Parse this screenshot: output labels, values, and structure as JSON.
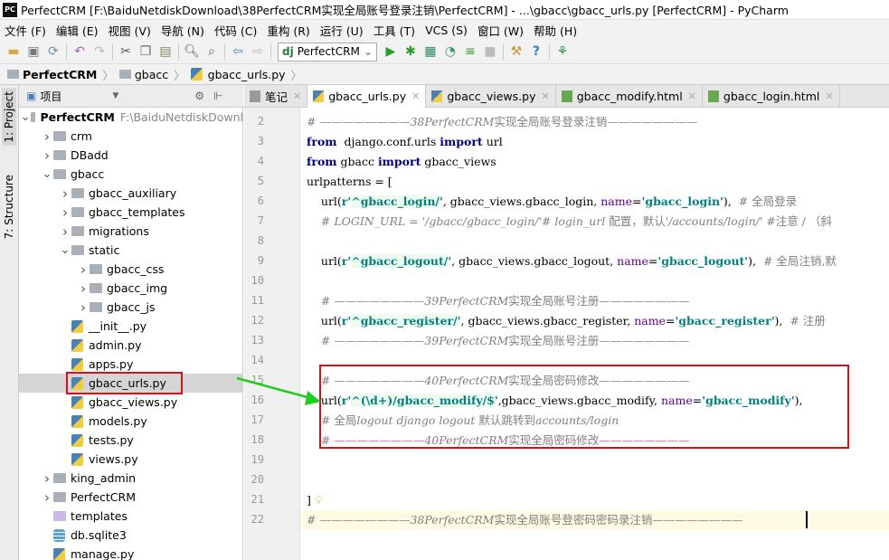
{
  "window": {
    "title": "PerfectCRM [F:\\BaiduNetdiskDownload\\38PerfectCRM实现全局账号登录注销\\PerfectCRM] - ...\\gbacc\\gbacc_urls.py [PerfectCRM] - PyCharm",
    "logo": "PC"
  },
  "menu": [
    "文件 (F)",
    "编辑 (E)",
    "视图 (V)",
    "导航 (N)",
    "代码 (C)",
    "重构 (R)",
    "运行 (U)",
    "工具 (T)",
    "VCS (S)",
    "窗口 (W)",
    "帮助 (H)"
  ],
  "toolbar": {
    "run_config": "PerfectCRM"
  },
  "breadcrumb": [
    "PerfectCRM",
    "gbacc",
    "gbacc_urls.py"
  ],
  "left_strip": {
    "project": "1: Project",
    "structure": "7: Structure"
  },
  "project_panel": {
    "title": "项目"
  },
  "tree": [
    {
      "label": "PerfectCRM",
      "path": "F:\\BaiduNetdiskDownl",
      "level": 0,
      "type": "folder",
      "expanded": true,
      "bold": true
    },
    {
      "label": "crm",
      "level": 1,
      "type": "folder",
      "expanded": false
    },
    {
      "label": "DBadd",
      "level": 1,
      "type": "folder",
      "expanded": false
    },
    {
      "label": "gbacc",
      "level": 1,
      "type": "folder",
      "expanded": true
    },
    {
      "label": "gbacc_auxiliary",
      "level": 2,
      "type": "folder",
      "expanded": false
    },
    {
      "label": "gbacc_templates",
      "level": 2,
      "type": "folder",
      "expanded": false
    },
    {
      "label": "migrations",
      "level": 2,
      "type": "folder",
      "expanded": false
    },
    {
      "label": "static",
      "level": 2,
      "type": "folder",
      "expanded": true
    },
    {
      "label": "gbacc_css",
      "level": 3,
      "type": "folder",
      "expanded": false
    },
    {
      "label": "gbacc_img",
      "level": 3,
      "type": "folder",
      "expanded": false
    },
    {
      "label": "gbacc_js",
      "level": 3,
      "type": "folder",
      "expanded": false
    },
    {
      "label": "__init__.py",
      "level": 2,
      "type": "py"
    },
    {
      "label": "admin.py",
      "level": 2,
      "type": "py"
    },
    {
      "label": "apps.py",
      "level": 2,
      "type": "py"
    },
    {
      "label": "gbacc_urls.py",
      "level": 2,
      "type": "py",
      "selected": true
    },
    {
      "label": "gbacc_views.py",
      "level": 2,
      "type": "py"
    },
    {
      "label": "models.py",
      "level": 2,
      "type": "py"
    },
    {
      "label": "tests.py",
      "level": 2,
      "type": "py"
    },
    {
      "label": "views.py",
      "level": 2,
      "type": "py"
    },
    {
      "label": "king_admin",
      "level": 1,
      "type": "folder",
      "expanded": false
    },
    {
      "label": "PerfectCRM",
      "level": 1,
      "type": "folder",
      "expanded": false
    },
    {
      "label": "templates",
      "level": 1,
      "type": "template-folder"
    },
    {
      "label": "db.sqlite3",
      "level": 1,
      "type": "db"
    },
    {
      "label": "manage.py",
      "level": 1,
      "type": "py"
    }
  ],
  "tabs": [
    {
      "label": "笔记",
      "icon": "note",
      "active": false
    },
    {
      "label": "gbacc_urls.py",
      "icon": "py",
      "active": true
    },
    {
      "label": "gbacc_views.py",
      "icon": "py",
      "active": false
    },
    {
      "label": "gbacc_modify.html",
      "icon": "html",
      "active": false
    },
    {
      "label": "gbacc_login.html",
      "icon": "html",
      "active": false
    }
  ],
  "editor": {
    "current_line": 22,
    "lines": [
      {
        "n": 2,
        "tokens": [
          [
            "cm",
            "# ————————"
          ],
          [
            "cm",
            "38PerfectCRM"
          ],
          [
            "cmcn",
            "实现全局账号登录注销"
          ],
          [
            "cm",
            "————————"
          ]
        ]
      },
      {
        "n": 3,
        "tokens": [
          [
            "kw",
            "from"
          ],
          [
            "",
            "  django.conf.urls "
          ],
          [
            "kw",
            "import"
          ],
          [
            "",
            " url"
          ]
        ]
      },
      {
        "n": 4,
        "tokens": [
          [
            "kw",
            "from"
          ],
          [
            "",
            " gbacc "
          ],
          [
            "kw",
            "import"
          ],
          [
            "",
            " gbacc_views"
          ]
        ]
      },
      {
        "n": 5,
        "tokens": [
          [
            "",
            "urlpatterns = ["
          ]
        ]
      },
      {
        "n": 6,
        "tokens": [
          [
            "",
            "    url("
          ],
          [
            "str",
            "r'"
          ],
          [
            "strg",
            "^gbacc_login/"
          ],
          [
            "str",
            "'"
          ],
          [
            "",
            ", gbacc_views.gbacc_login, "
          ],
          [
            "kwarg",
            "name"
          ],
          [
            "",
            "="
          ],
          [
            "str",
            "'gbacc_login'"
          ],
          [
            "",
            "),  "
          ],
          [
            "cmcn",
            "# 全局登录"
          ]
        ]
      },
      {
        "n": 7,
        "tokens": [
          [
            "cm",
            "    # LOGIN_URL = '/gbacc/gbacc_login/'# login_url "
          ],
          [
            "cmcn",
            "配置，默认"
          ],
          [
            "cm",
            "'/accounts/login/' "
          ],
          [
            "cmcn",
            "#注意 / （斜"
          ]
        ]
      },
      {
        "n": 8,
        "tokens": []
      },
      {
        "n": 9,
        "tokens": [
          [
            "",
            "    url("
          ],
          [
            "str",
            "r'"
          ],
          [
            "strg",
            "^gbacc_logout/"
          ],
          [
            "str",
            "'"
          ],
          [
            "",
            ", gbacc_views.gbacc_logout, "
          ],
          [
            "kwarg",
            "name"
          ],
          [
            "",
            "="
          ],
          [
            "str",
            "'gbacc_logout'"
          ],
          [
            "",
            "),  "
          ],
          [
            "cmcn",
            "# 全局注销,默"
          ]
        ]
      },
      {
        "n": 10,
        "tokens": []
      },
      {
        "n": 11,
        "tokens": [
          [
            "cm",
            "    # ————————"
          ],
          [
            "cm",
            "39PerfectCRM"
          ],
          [
            "cmcn",
            "实现全局账号注册"
          ],
          [
            "cm",
            "————————"
          ]
        ]
      },
      {
        "n": 12,
        "tokens": [
          [
            "",
            "    url("
          ],
          [
            "str",
            "r'"
          ],
          [
            "strg",
            "^gbacc_register/"
          ],
          [
            "str",
            "'"
          ],
          [
            "",
            ", gbacc_views.gbacc_register, "
          ],
          [
            "kwarg",
            "name"
          ],
          [
            "",
            "="
          ],
          [
            "str",
            "'gbacc_register'"
          ],
          [
            "",
            "),  "
          ],
          [
            "cmcn",
            "# 注册"
          ]
        ]
      },
      {
        "n": 13,
        "tokens": [
          [
            "cm",
            "    # ————————"
          ],
          [
            "cm",
            "39PerfectCRM"
          ],
          [
            "cmcn",
            "实现全局账号注册"
          ],
          [
            "cm",
            "————————"
          ]
        ]
      },
      {
        "n": 14,
        "tokens": []
      },
      {
        "n": 15,
        "tokens": [
          [
            "cm",
            "    # ————————"
          ],
          [
            "cm",
            "40PerfectCRM"
          ],
          [
            "cmcn",
            "实现全局密码修改"
          ],
          [
            "cm",
            "————————"
          ]
        ]
      },
      {
        "n": 16,
        "tokens": [
          [
            "",
            "    url("
          ],
          [
            "str",
            "r'"
          ],
          [
            "strg",
            "^(\\d+)/gbacc_modify/$"
          ],
          [
            "str",
            "'"
          ],
          [
            "",
            ",gbacc_views.gbacc_modify, "
          ],
          [
            "kwarg",
            "name"
          ],
          [
            "",
            "="
          ],
          [
            "str",
            "'gbacc_modify'"
          ],
          [
            "",
            "),"
          ]
        ]
      },
      {
        "n": 17,
        "tokens": [
          [
            "cmcn",
            "    # 全局"
          ],
          [
            "cm",
            "logout django logout "
          ],
          [
            "cmcn",
            "默认跳转到"
          ],
          [
            "cm",
            "accounts/login"
          ]
        ]
      },
      {
        "n": 18,
        "tokens": [
          [
            "cm",
            "    # ————————"
          ],
          [
            "cm",
            "40PerfectCRM"
          ],
          [
            "cmcn",
            "实现全局密码修改"
          ],
          [
            "cm",
            "————————"
          ]
        ]
      },
      {
        "n": 19,
        "tokens": []
      },
      {
        "n": 20,
        "tokens": []
      },
      {
        "n": 21,
        "tokens": [
          [
            "",
            "]"
          ]
        ]
      },
      {
        "n": 22,
        "tokens": [
          [
            "cm",
            "# ————————"
          ],
          [
            "cm",
            "38PerfectCRM"
          ],
          [
            "cmcn",
            "实现全局账号登密码密码录注销"
          ],
          [
            "cm",
            "————————"
          ]
        ]
      }
    ]
  },
  "annotations": {
    "highlight_color": "#d0101a",
    "arrow_color": "#22cc22"
  }
}
